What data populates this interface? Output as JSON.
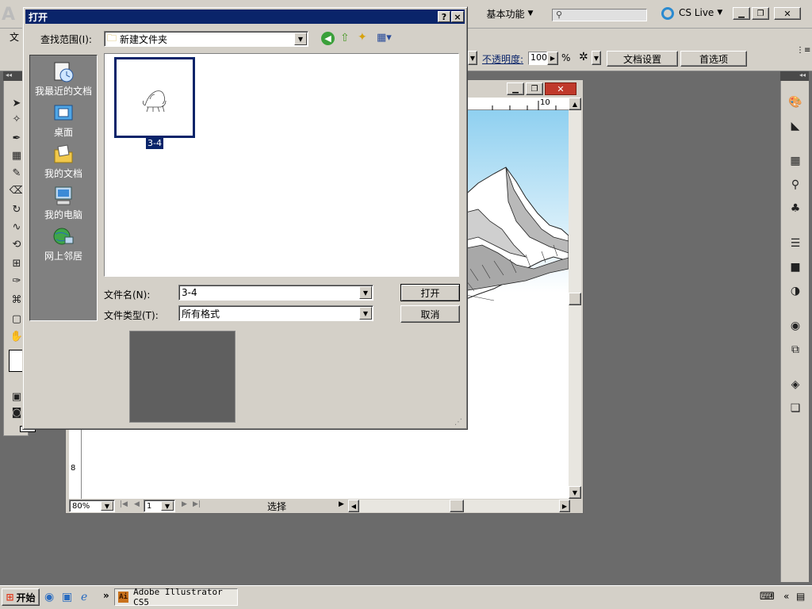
{
  "app": {
    "workspace_label": "基本功能",
    "cs_live_label": "CS Live",
    "menu_first": "文",
    "opacity_label": "不透明度:",
    "opacity_value": "100",
    "opacity_unit": "%",
    "doc_settings_button": "文档设置",
    "preferences_button": "首选项"
  },
  "document": {
    "ruler_top_label": "10",
    "ruler_left_label": "8",
    "zoom_value": "80%",
    "page_value": "1",
    "status_text": "选择"
  },
  "dialog": {
    "title": "打开",
    "help_button": "?",
    "close_button": "×",
    "look_in_label": "查找范围(I):",
    "look_in_value": "新建文件夹",
    "places": [
      {
        "label": "我最近的文档",
        "icon": "recent-documents-icon"
      },
      {
        "label": "桌面",
        "icon": "desktop-icon"
      },
      {
        "label": "我的文档",
        "icon": "my-documents-icon"
      },
      {
        "label": "我的电脑",
        "icon": "my-computer-icon"
      },
      {
        "label": "网上邻居",
        "icon": "network-places-icon"
      }
    ],
    "files": [
      {
        "name": "3-4"
      }
    ],
    "filename_label": "文件名(N):",
    "filename_value": "3-4",
    "filetype_label": "文件类型(T):",
    "filetype_value": "所有格式",
    "open_button": "打开",
    "cancel_button": "取消"
  },
  "taskbar": {
    "start_label": "开始",
    "task_label": "Adobe Illustrator CS5",
    "task_icon_text": "Ai",
    "more_label": "»"
  }
}
